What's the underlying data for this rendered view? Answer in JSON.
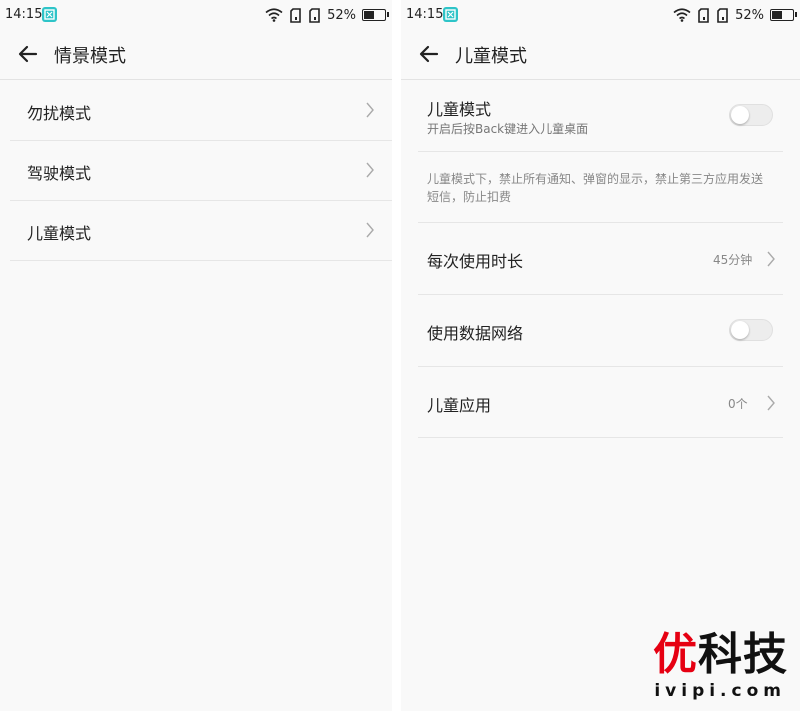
{
  "status_bar": {
    "time": "14:15",
    "battery_percent": "52%",
    "battery_level": 0.52
  },
  "left": {
    "title": "情景模式",
    "items": [
      {
        "label": "勿扰模式"
      },
      {
        "label": "驾驶模式"
      },
      {
        "label": "儿童模式"
      }
    ]
  },
  "right": {
    "title": "儿童模式",
    "kids_mode": {
      "label": "儿童模式",
      "subtitle": "开启后按Back键进入儿童桌面",
      "enabled": false
    },
    "description": "儿童模式下，禁止所有通知、弹窗的显示，禁止第三方应用发送短信，防止扣费",
    "usage_time": {
      "label": "每次使用时长",
      "value": "45分钟"
    },
    "mobile_data": {
      "label": "使用数据网络",
      "enabled": false
    },
    "kids_apps": {
      "label": "儿童应用",
      "value": "0个"
    }
  },
  "watermark": {
    "logo": "优科技",
    "url": "ivipi.com",
    "accent": "#e60012"
  }
}
